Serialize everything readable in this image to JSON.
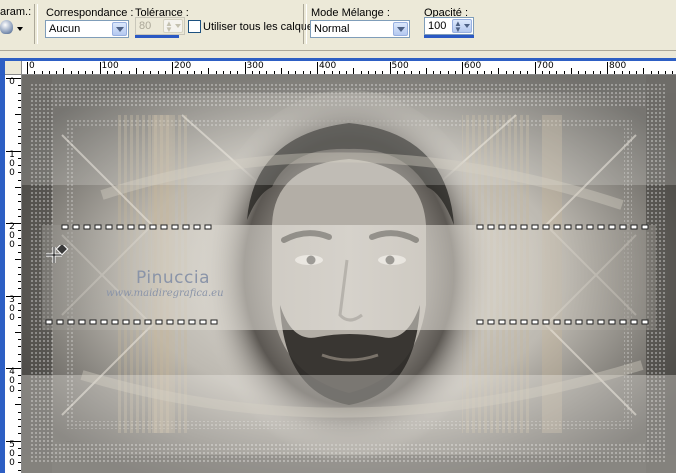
{
  "toolbar": {
    "param_label": "aram.:",
    "match_label": "Correspondance :",
    "match_value": "Aucun",
    "tolerance_label": "Tolérance :",
    "tolerance_value": "80",
    "use_all_layers_label": "Utiliser tous les calques",
    "blend_mode_label": "Mode Mélange :",
    "blend_mode_value": "Normal",
    "opacity_label": "Opacité :",
    "opacity_value": "100"
  },
  "ruler_horizontal": [
    "0",
    "100",
    "200",
    "300",
    "400",
    "500",
    "600",
    "700",
    "800"
  ],
  "ruler_vertical": [
    {
      "label": "0",
      "digits": [
        "0"
      ]
    },
    {
      "label": "100",
      "digits": [
        "1",
        "0",
        "0"
      ]
    },
    {
      "label": "200",
      "digits": [
        "2",
        "0",
        "0"
      ]
    },
    {
      "label": "300",
      "digits": [
        "3",
        "0",
        "0"
      ]
    },
    {
      "label": "400",
      "digits": [
        "4",
        "0",
        "0"
      ]
    },
    {
      "label": "500",
      "digits": [
        "5",
        "0",
        "0"
      ]
    }
  ],
  "canvas": {
    "watermark_name": "Pinuccia",
    "watermark_url": "www.maidiregrafica.eu"
  },
  "colors": {
    "selection_blue": "#2d5fc4",
    "accent_tone": "#c9b89a",
    "watermark": "#8a94a8"
  }
}
